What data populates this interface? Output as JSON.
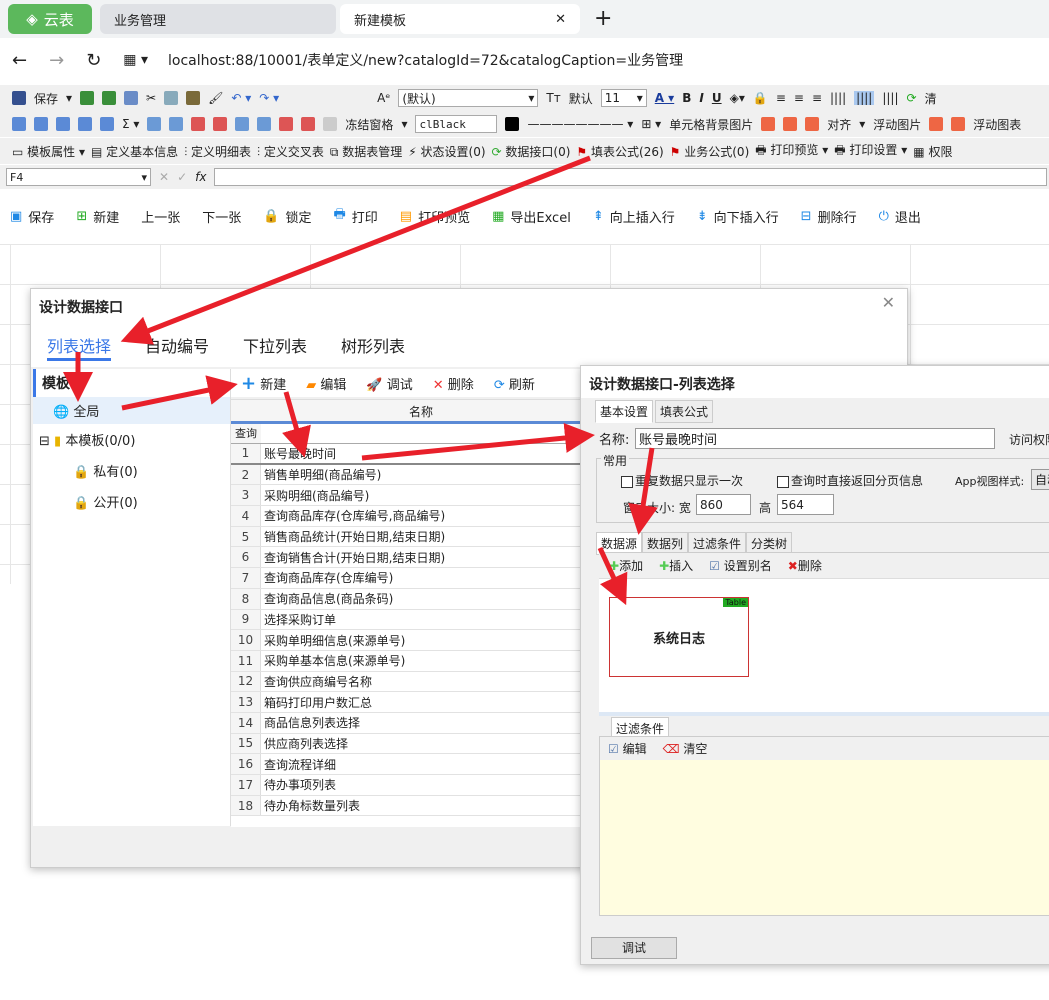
{
  "browser": {
    "brand": "云表",
    "tabs": [
      "业务管理",
      "新建模板"
    ],
    "url": "localhost:88/10001/表单定义/new?catalogId=72&catalogCaption=业务管理"
  },
  "toolbar1": {
    "save": "保存",
    "font": "(默认)",
    "default": "默认",
    "size": "11",
    "clear": "清"
  },
  "toolbar2": {
    "freeze": "冻结窗格",
    "color": "clBlack",
    "cell_bg": "单元格背景图片",
    "align": "对齐",
    "float_img": "浮动图片",
    "float_chart": "浮动图表"
  },
  "toolbar3": [
    "模板属性",
    "定义基本信息",
    "定义明细表",
    "定义交叉表",
    "数据表管理",
    "状态设置(0)",
    "数据接口(0)",
    "填表公式(26)",
    "业务公式(0)",
    "打印预览",
    "打印设置",
    "权限"
  ],
  "formula": {
    "cell": "F4",
    "fx": "fx"
  },
  "actions": [
    "保存",
    "新建",
    "上一张",
    "下一张",
    "锁定",
    "打印",
    "打印预览",
    "导出Excel",
    "向上插入行",
    "向下插入行",
    "删除行",
    "退出"
  ],
  "dialog1": {
    "title": "设计数据接口",
    "tabs": [
      "列表选择",
      "自动编号",
      "下拉列表",
      "树形列表"
    ],
    "tree": {
      "header": "模板",
      "items": [
        "全局",
        "本模板(0/0)",
        "私有(0)",
        "公开(0)"
      ]
    },
    "toolbar": [
      "新建",
      "编辑",
      "调试",
      "删除",
      "刷新"
    ],
    "col_header": "名称",
    "query": "查询",
    "rows": [
      "账号最晚时间",
      "销售单明细(商品编号)",
      "采购明细(商品编号)",
      "查询商品库存(仓库编号,商品编号)",
      "销售商品统计(开始日期,结束日期)",
      "查询销售合计(开始日期,结束日期)",
      "查询商品库存(仓库编号)",
      "查询商品信息(商品条码)",
      "选择采购订单",
      "采购单明细信息(来源单号)",
      "采购单基本信息(来源单号)",
      "查询供应商编号名称",
      "箱码打印用户数汇总",
      "商品信息列表选择",
      "供应商列表选择",
      "查询流程详细",
      "待办事项列表",
      "待办角标数量列表"
    ]
  },
  "dialog2": {
    "title": "设计数据接口-列表选择",
    "tabs": [
      "基本设置",
      "填表公式"
    ],
    "name_label": "名称:",
    "name_value": "账号最晚时间",
    "access": "访问权限",
    "group": "常用",
    "chk1": "重复数据只显示一次",
    "chk2": "查询时直接返回分页信息",
    "app_view": "App视图样式:",
    "app_value": "自动",
    "win_size": "窗口大小: 宽",
    "width": "860",
    "height_label": "高",
    "height": "564",
    "subtabs": [
      "数据源",
      "数据列",
      "过滤条件",
      "分类树"
    ],
    "ds_toolbar": [
      "添加",
      "插入",
      "设置别名",
      "删除"
    ],
    "table_name": "系统日志",
    "table_tag": "Table",
    "filter_tab": "过滤条件",
    "filter_toolbar": [
      "编辑",
      "清空"
    ],
    "debug": "调试"
  }
}
